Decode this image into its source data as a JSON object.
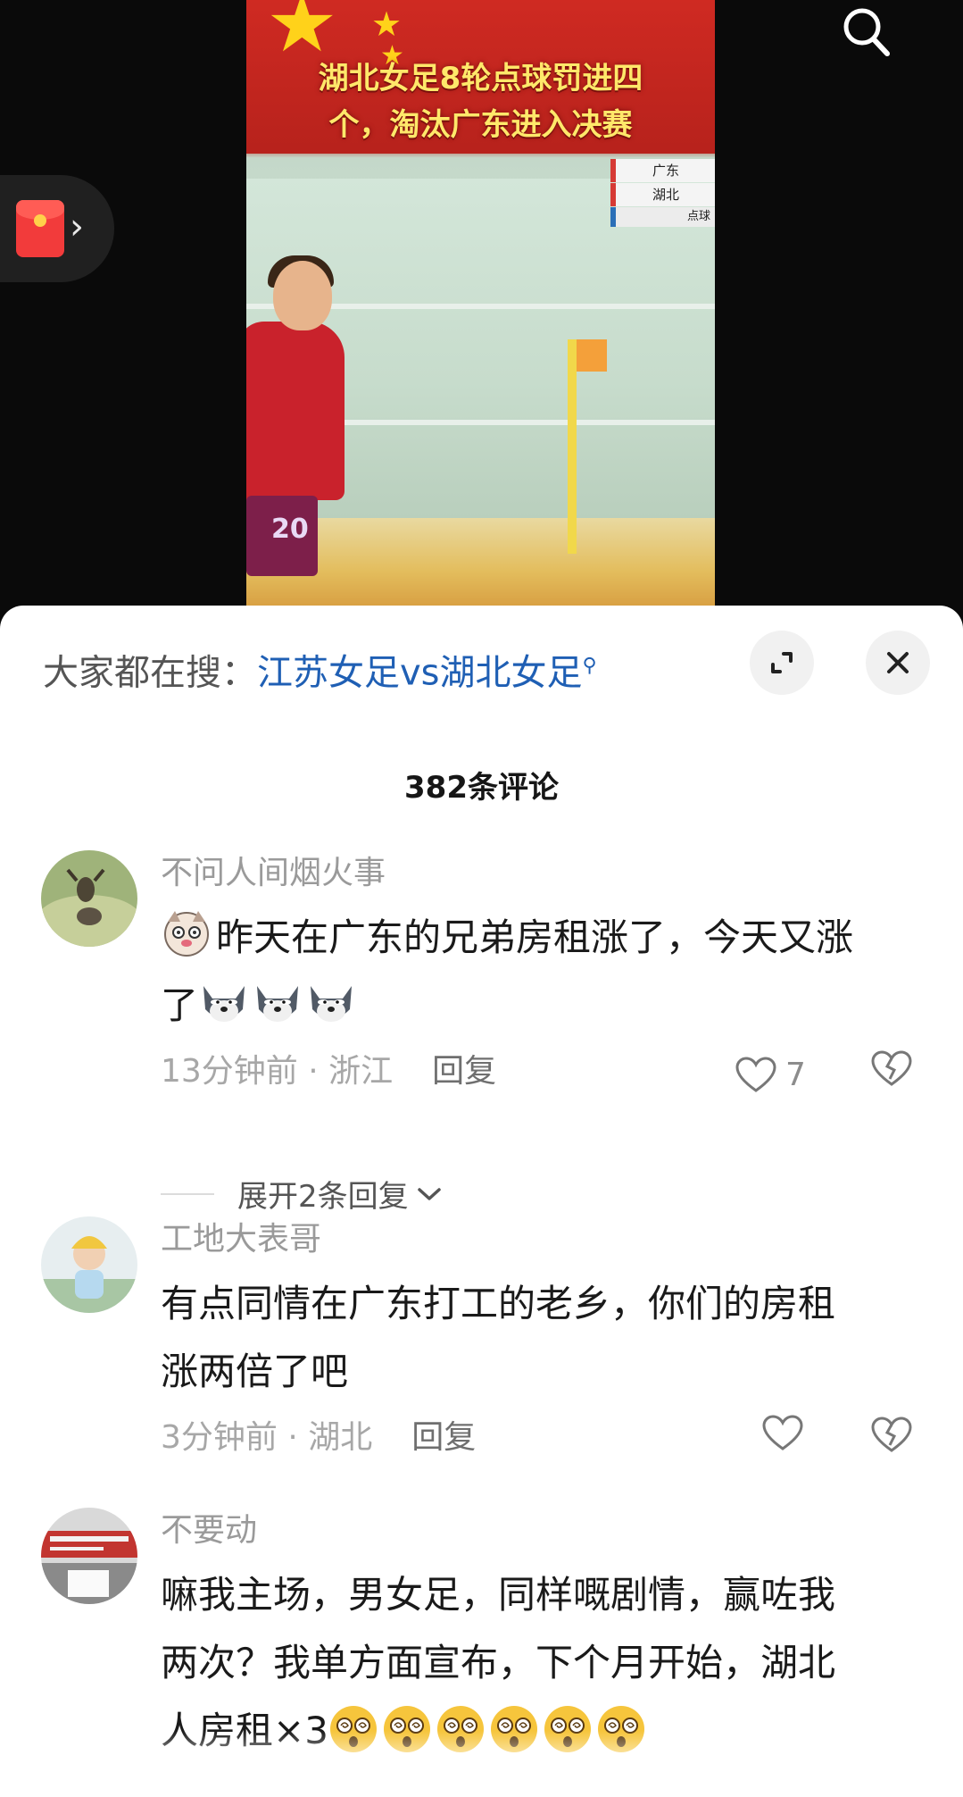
{
  "video": {
    "headline_line1": "湖北女足8轮点球罚进四",
    "headline_line2": "个，淘汰广东进入决赛",
    "scoreboard": {
      "team1": "广东",
      "team2": "湖北",
      "status": "点球"
    },
    "jersey_number": "20",
    "colors": {
      "banner_red": "#c9221c",
      "headline_yellow": "#ffe86a"
    }
  },
  "floating": {
    "redpacket_icon": "red-envelope-icon",
    "arrow_icon": "chevron-right-icon"
  },
  "top_search_icon": "search-icon",
  "sheet": {
    "search_prefix": "大家都在搜：",
    "search_query": "江苏女足vs湖北女足",
    "comment_count": "382条评论",
    "expand_icon": "expand-icon",
    "close_icon": "close-icon"
  },
  "comments": [
    {
      "user": "不问人间烟火事",
      "text_part1": "昨天在广东的兄弟房租涨了，今天又涨",
      "text_part2": "了",
      "time_location": "13分钟前 · 浙江",
      "reply": "回复",
      "likes": "7",
      "expand_replies": "展开2条回复"
    },
    {
      "user": "工地大表哥",
      "text_line1": "有点同情在广东打工的老乡，你们的房租",
      "text_line2": "涨两倍了吧",
      "time_location": "3分钟前 · 湖北",
      "reply": "回复"
    },
    {
      "user": "不要动",
      "text_line1": "嘛我主场，男女足，同样嘅剧情，赢咗我",
      "text_line2": "两次？我单方面宣布，下个月开始，湖北",
      "text_line3": "人房租×3"
    }
  ]
}
